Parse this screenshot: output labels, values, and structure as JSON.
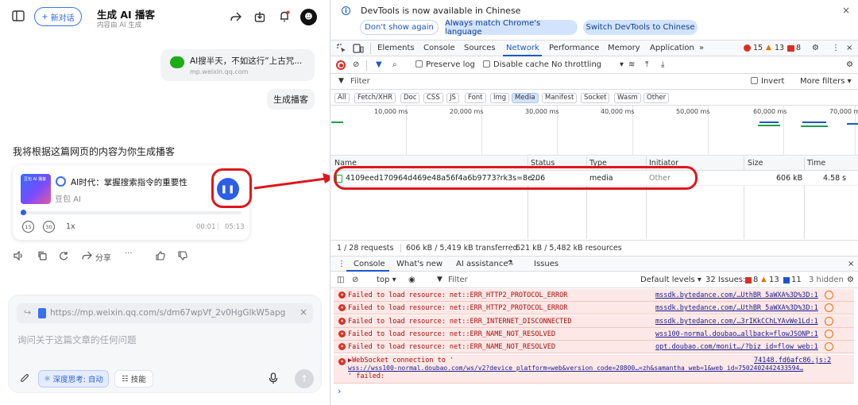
{
  "left": {
    "new_chat": "新对话",
    "title": "生成 AI 播客",
    "subtitle": "内容由 AI 生成",
    "avatar_glyph": "☻",
    "link_card": {
      "title": "AI搜半天，不如这行“上古咒...",
      "url": "mp.weixin.qq.com"
    },
    "user_bubble": "生成播客",
    "reply": "我将根据这篇网页的内容为你生成播客",
    "podcast": {
      "cover_text": "豆包 AI 播客",
      "title": "AI时代：掌握搜索指令的重要性",
      "author": "豆包 AI",
      "pause_glyph": "❚❚",
      "rewind": "15",
      "forward": "30",
      "speed": "1x",
      "time_current": "00:01",
      "time_sep": "|",
      "time_total": "05:13",
      "progress_fraction": 0.01
    },
    "actions": {
      "share": "分享",
      "more": "···"
    },
    "input": {
      "url": "https://mp.weixin.qq.com/s/dm67wpVf_2v0HgGlkW5apg",
      "url_close": "×",
      "placeholder": "询问关于这篇文章的任何问题",
      "deep_think": "深度思考: 自动",
      "skills": "技能",
      "send_glyph": "↑"
    }
  },
  "devtools": {
    "info": {
      "text": "DevTools is now available in Chinese",
      "close": "×",
      "btn_dont_show": "Don't show again",
      "btn_match": "Always match Chrome's language",
      "btn_switch": "Switch DevTools to Chinese"
    },
    "tabs": [
      "Elements",
      "Console",
      "Sources",
      "Network",
      "Performance",
      "Memory",
      "Application",
      "»"
    ],
    "counts": {
      "errors": "15",
      "warnings": "13",
      "info": "8"
    },
    "toolbar": {
      "preserve_log": "Preserve log",
      "disable_cache": "Disable cache",
      "throttling": "No throttling"
    },
    "filter": {
      "placeholder": "Filter",
      "invert": "Invert",
      "more_filters": "More filters ▾"
    },
    "types": [
      "All",
      "Fetch/XHR",
      "Doc",
      "CSS",
      "JS",
      "Font",
      "Img",
      "Media",
      "Manifest",
      "Socket",
      "Wasm",
      "Other"
    ],
    "timeline_ticks": [
      "10,000 ms",
      "20,000 ms",
      "30,000 ms",
      "40,000 ms",
      "50,000 ms",
      "60,000 ms",
      "70,000 m"
    ],
    "columns": {
      "name": "Name",
      "status": "Status",
      "type": "Type",
      "initiator": "Initiator",
      "size": "Size",
      "time": "Time"
    },
    "request": {
      "name": "4109eed170964d469e48a56f4a6b9773?rk3s=8e...",
      "status": "206",
      "type": "media",
      "initiator": "Other",
      "size": "606 kB",
      "time": "4.58 s"
    },
    "status_bar": {
      "requests": "1 / 28 requests",
      "transferred": "606 kB / 5,419 kB transferred",
      "resources": "621 kB / 5,482 kB resources"
    },
    "console_tabs": {
      "console": "Console",
      "whats_new": "What's new",
      "ai": "AI assistance",
      "issues": "Issues"
    },
    "console_toolbar": {
      "context": "top ▾",
      "filter": "Filter",
      "levels": "Default levels ▾",
      "issues_label": "32 Issues:",
      "issues_err": "8",
      "issues_warn": "13",
      "issues_info": "11",
      "hidden": "3 hidden"
    },
    "errors": [
      {
        "msg": "Failed to load resource: net::ERR_HTTP2_PROTOCOL_ERROR",
        "src": "mssdk.bytedance.com/…UthBR_5aWXA%3D%3D:1"
      },
      {
        "msg": "Failed to load resource: net::ERR_HTTP2_PROTOCOL_ERROR",
        "src": "mssdk.bytedance.com/…UthBR_5aWXA%3D%3D:1"
      },
      {
        "msg": "Failed to load resource: net::ERR_INTERNET_DISCONNECTED",
        "src": "mssdk.bytedance.com/…3rIKkCChLYAvWe1Ld:1"
      },
      {
        "msg": "Failed to load resource: net::ERR_NAME_NOT_RESOLVED",
        "src": "wss100-normal.doubao…allback=flowJSONP:1"
      },
      {
        "msg": "Failed to load resource: net::ERR_NAME_NOT_RESOLVED",
        "src": "opt.doubao.com/monit…/?biz_id=flow_web:1"
      }
    ],
    "websocket": {
      "line1": "▶WebSocket connection to '",
      "src": "74148.fd6afc86.js:2",
      "line2": "wss://wss100-normal.doubao.com/ws/v2?device_platform=web&version_code=20800…=zh&samantha_web=1&web_id=7502402442433594…",
      "line3": "' failed:"
    },
    "prompt": "›"
  }
}
